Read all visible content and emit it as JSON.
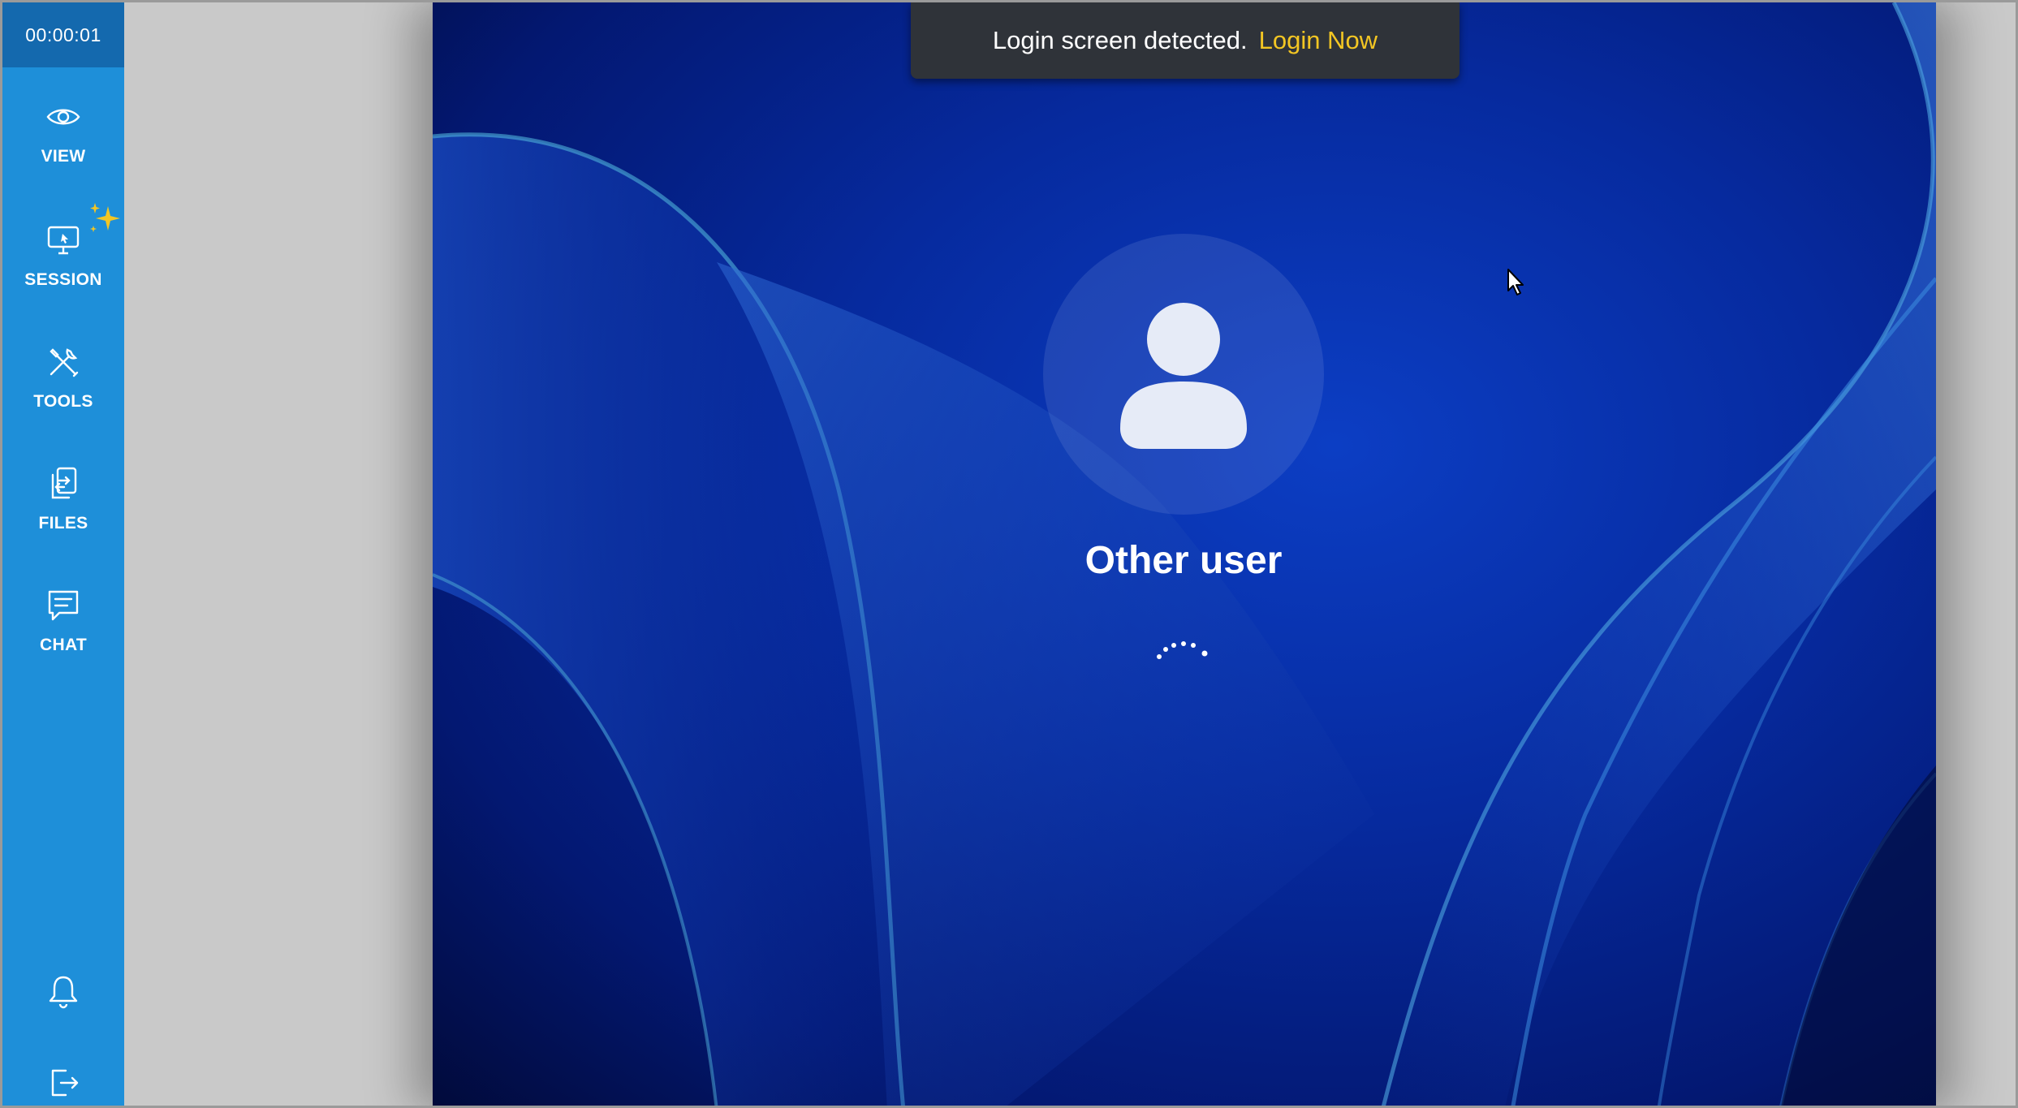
{
  "sidebar": {
    "timer": "00:00:01",
    "items": [
      {
        "label": "VIEW",
        "icon": "eye-icon"
      },
      {
        "label": "SESSION",
        "icon": "monitor-icon"
      },
      {
        "label": "TOOLS",
        "icon": "tools-icon"
      },
      {
        "label": "FILES",
        "icon": "files-icon"
      },
      {
        "label": "CHAT",
        "icon": "chat-icon"
      }
    ],
    "bottom_icons": [
      "bell-icon",
      "logout-icon"
    ]
  },
  "toast": {
    "message": "Login screen detected.",
    "action": "Login Now"
  },
  "login": {
    "username": "Other user"
  },
  "colors": {
    "sidebar": "#1e8fd9",
    "timer_bg": "#1469ae",
    "toast_bg": "#2f3339",
    "toast_link": "#f3c623",
    "sparkle": "#f3c623"
  }
}
